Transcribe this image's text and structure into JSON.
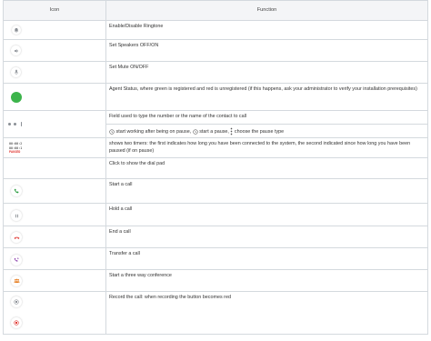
{
  "table": {
    "headers": [
      "Icon",
      "Function"
    ],
    "rows": [
      {
        "icon": "bell-icon",
        "function": "Enable/Disable Ringtone"
      },
      {
        "icon": "speaker-icon",
        "function": "Set Speakers OFF/ON"
      },
      {
        "icon": "microphone-icon",
        "function": "Set Mute ON/OFF"
      },
      {
        "icon": "agent-status-dot-icon",
        "function": "Agent Status, where green is registered and red is unregistered (if this happens, ask your administrator to verify your installation prerequisites)"
      },
      {
        "icon": "number-input-dots-icon",
        "function": "Field used to type the number or the name of the contact to call"
      },
      {
        "icon": "pause-options-icon",
        "function_parts": [
          "start working after being on pause,",
          "start a pause,",
          "choose the pause type"
        ]
      },
      {
        "icon": "timers-icon",
        "timers": [
          "00:00:2",
          "00:00:1",
          "PAUSED"
        ],
        "function": "shows two timers: the first indicates how long you have been connected to the system, the second indicated since how long you have been paused (if on pause)"
      },
      {
        "icon": "dialpad-icon",
        "function": "Click to show the dial pad"
      },
      {
        "icon": "phone-call-icon",
        "function": "Start a call"
      },
      {
        "icon": "hold-icon",
        "function": "Hold a call"
      },
      {
        "icon": "end-call-icon",
        "function": "End a call"
      },
      {
        "icon": "transfer-icon",
        "function": "Transfer a call"
      },
      {
        "icon": "conference-icon",
        "function": "Start a three way conference"
      },
      {
        "icon": "record-icon",
        "function": "Record the call: when recording the button becomes red"
      }
    ]
  },
  "colors": {
    "green_status": "#3cb44b",
    "red": "#e0332e",
    "call_green": "#2e9e44",
    "purple": "#8e44ad",
    "orange": "#e67e22",
    "icon_grey": "#8a8f95"
  }
}
